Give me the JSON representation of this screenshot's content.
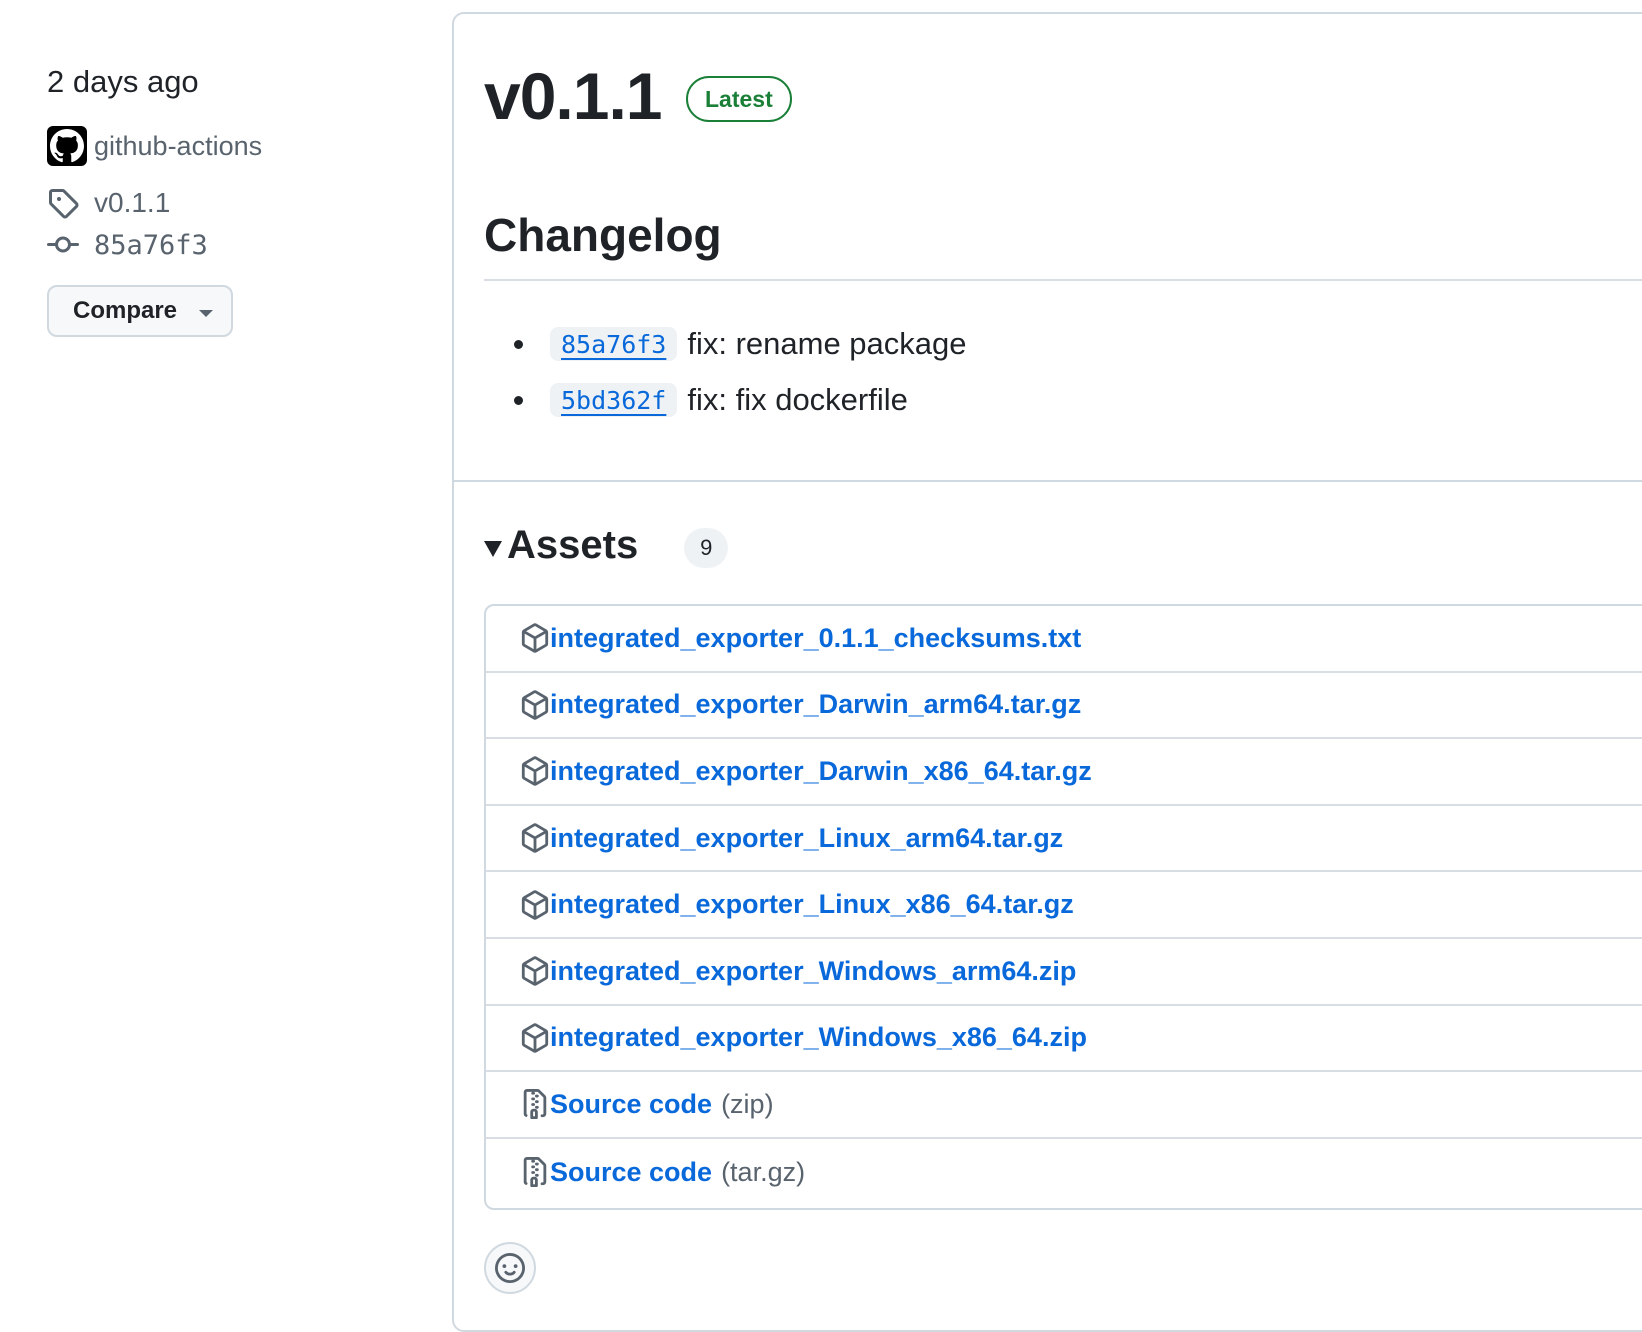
{
  "meta": {
    "date": "2 days ago",
    "author": "github-actions",
    "tag": "v0.1.1",
    "commit": "85a76f3",
    "compare_label": "Compare"
  },
  "release": {
    "title": "v0.1.1",
    "badge": "Latest",
    "section_heading": "Changelog",
    "changes": [
      {
        "sha": "85a76f3",
        "text": "fix: rename package"
      },
      {
        "sha": "5bd362f",
        "text": "fix: fix dockerfile"
      }
    ]
  },
  "assets": {
    "title": "Assets",
    "count": "9",
    "items": [
      {
        "name": "integrated_exporter_0.1.1_checksums.txt",
        "suffix": "",
        "icon": "package-icon"
      },
      {
        "name": "integrated_exporter_Darwin_arm64.tar.gz",
        "suffix": "",
        "icon": "package-icon"
      },
      {
        "name": "integrated_exporter_Darwin_x86_64.tar.gz",
        "suffix": "",
        "icon": "package-icon"
      },
      {
        "name": "integrated_exporter_Linux_arm64.tar.gz",
        "suffix": "",
        "icon": "package-icon"
      },
      {
        "name": "integrated_exporter_Linux_x86_64.tar.gz",
        "suffix": "",
        "icon": "package-icon"
      },
      {
        "name": "integrated_exporter_Windows_arm64.zip",
        "suffix": "",
        "icon": "package-icon"
      },
      {
        "name": "integrated_exporter_Windows_x86_64.zip",
        "suffix": "",
        "icon": "package-icon"
      },
      {
        "name": "Source code",
        "suffix": "(zip)",
        "icon": "file-zip-icon"
      },
      {
        "name": "Source code",
        "suffix": "(tar.gz)",
        "icon": "file-zip-icon"
      }
    ]
  },
  "colors": {
    "link": "#0969da",
    "latest_green": "#1a7f37",
    "border": "#d1d9e0",
    "muted_text": "#59636e"
  }
}
